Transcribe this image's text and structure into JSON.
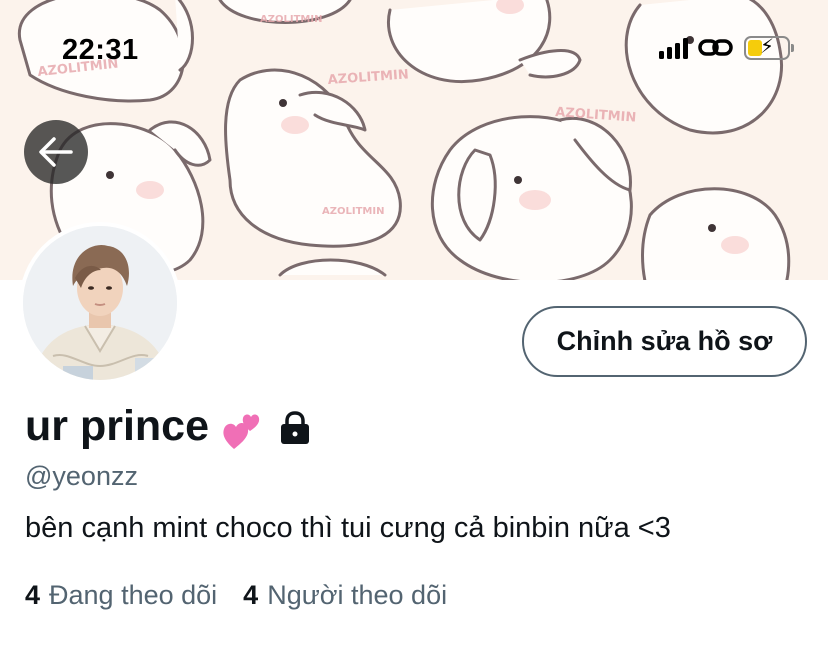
{
  "status_bar": {
    "time": "22:31",
    "icons": [
      "cellular-signal-icon",
      "link-icon",
      "battery-charging-icon"
    ],
    "battery_color": "#f5cc0b"
  },
  "header": {
    "banner_watermark": "AZOLITMIN",
    "back_icon": "arrow-left-icon"
  },
  "profile": {
    "display_name": "ur prince",
    "name_emoji": "💕",
    "protected_icon": "lock-icon",
    "handle": "@yeonzz",
    "bio": "bên cạnh mint choco thì tui cưng cả binbin nữa <3",
    "edit_button_label": "Chỉnh sửa hồ sơ",
    "following_count": "4",
    "following_label": "Đang theo dõi",
    "followers_count": "4",
    "followers_label": "Người theo dõi"
  },
  "colors": {
    "primary_text": "#0f1419",
    "secondary_text": "#536471",
    "banner_background": "#fcf3ec"
  }
}
